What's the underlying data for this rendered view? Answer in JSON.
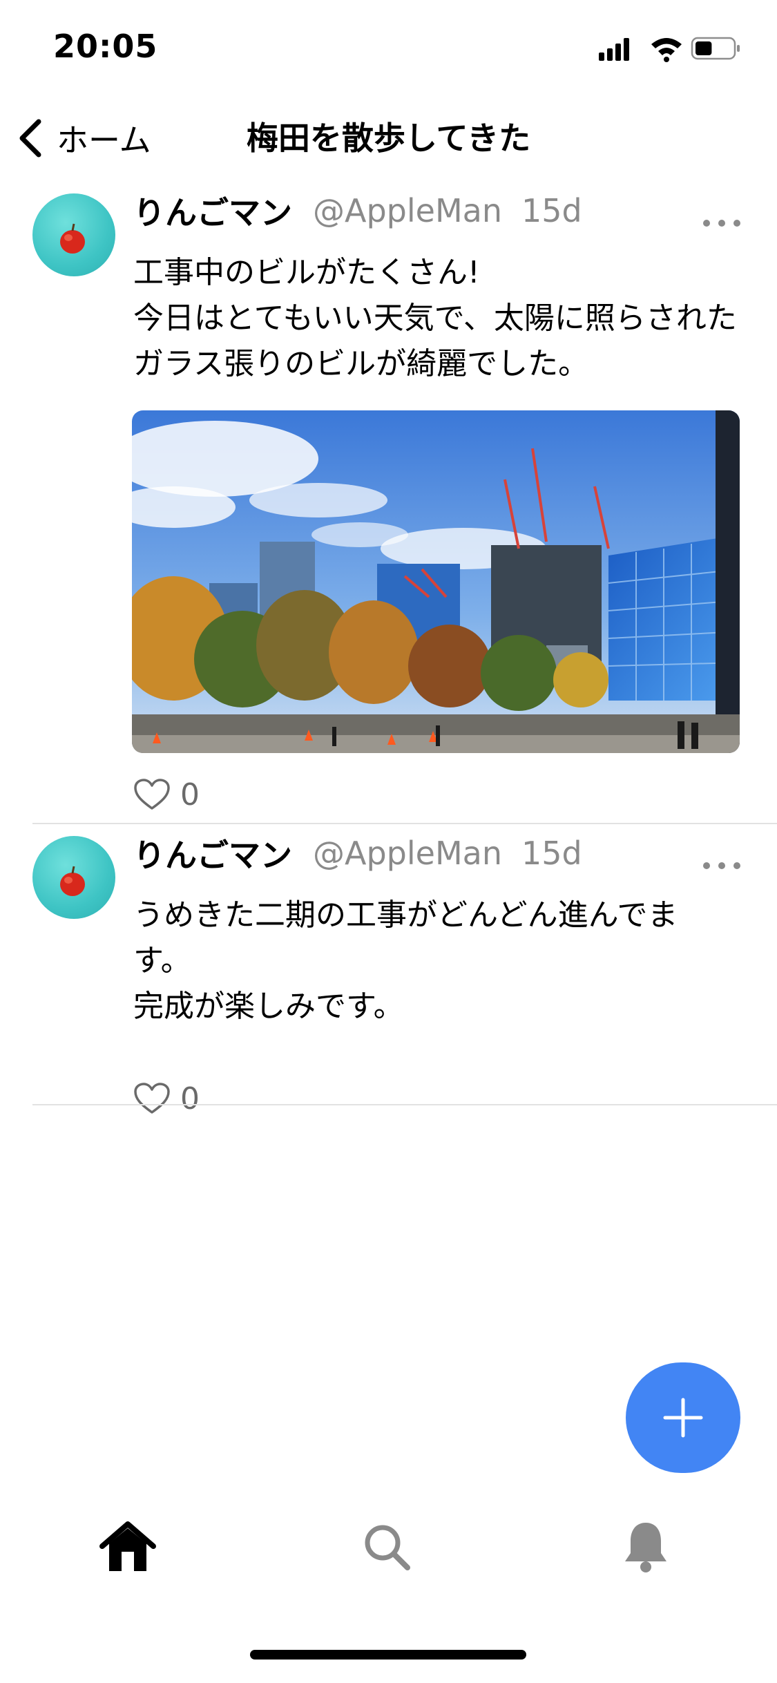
{
  "status_bar": {
    "time": "20:05",
    "battery_level": 0.45
  },
  "nav": {
    "back_label": "ホーム",
    "title": "梅田を散歩してきた"
  },
  "posts": [
    {
      "user_name": "りんごマン",
      "handle": "@AppleMan",
      "ago": "15d",
      "text": "工事中のビルがたくさん!\n今日はとてもいい天気で、太陽に照らされたガラス張りのビルが綺麗でした。",
      "has_image": true,
      "likes": "0"
    },
    {
      "user_name": "りんごマン",
      "handle": "@AppleMan",
      "ago": "15d",
      "text": "うめきた二期の工事がどんどん進んでます。\n完成が楽しみです。",
      "has_image": false,
      "likes": "0"
    }
  ],
  "colors": {
    "accent": "#4285f4",
    "muted": "#8a8a8a",
    "divider": "#e2e2e2",
    "avatar_bg": "#3ec4c4"
  },
  "icons": {
    "back": "chevron-left-icon",
    "more": "more-horizontal-icon",
    "like": "heart-outline-icon",
    "fab": "plus-icon",
    "tabs": [
      "home-icon",
      "search-icon",
      "bell-icon"
    ]
  }
}
